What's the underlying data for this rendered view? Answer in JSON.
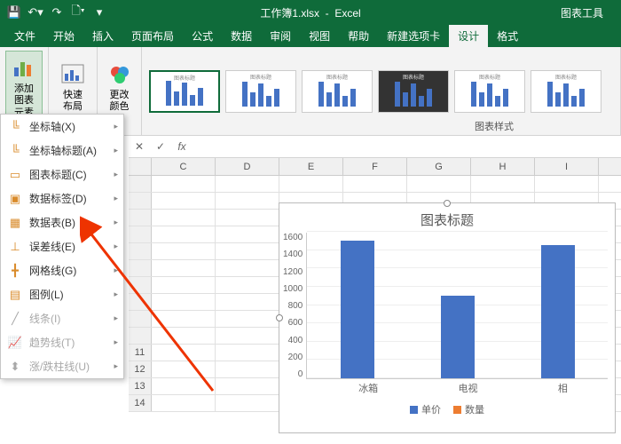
{
  "title": {
    "filename": "工作簿1.xlsx",
    "app": "Excel",
    "contextTab": "图表工具"
  },
  "tabs": {
    "file": "文件",
    "home": "开始",
    "insert": "插入",
    "pageLayout": "页面布局",
    "formulas": "公式",
    "data": "数据",
    "review": "审阅",
    "view": "视图",
    "help": "帮助",
    "newTab": "新建选项卡",
    "design": "设计",
    "format": "格式"
  },
  "ribbon": {
    "addChartElement": "添加图表\n元素",
    "quickLayout": "快速布局",
    "changeColors": "更改\n颜色",
    "chartStyles": "图表样式"
  },
  "menu": {
    "axes": "坐标轴(X)",
    "axisTitles": "坐标轴标题(A)",
    "chartTitle": "图表标题(C)",
    "dataLabels": "数据标签(D)",
    "dataTable": "数据表(B)",
    "errorBars": "误差线(E)",
    "gridlines": "网格线(G)",
    "legend": "图例(L)",
    "lines": "线条(I)",
    "trendline": "趋势线(T)",
    "upDownBars": "涨/跌柱线(U)"
  },
  "formula": {
    "fx": "fx"
  },
  "columns": [
    "C",
    "D",
    "E",
    "F",
    "G",
    "H",
    "I"
  ],
  "rows": [
    "11",
    "12",
    "13",
    "14"
  ],
  "chart_data": {
    "type": "bar",
    "title": "图表标题",
    "categories": [
      "冰箱",
      "电视",
      "相"
    ],
    "series": [
      {
        "name": "单价",
        "values": [
          1500,
          900,
          1450
        ]
      },
      {
        "name": "数量",
        "values": [
          20,
          18,
          22
        ]
      }
    ],
    "ylim": [
      0,
      1600
    ],
    "yticks": [
      0,
      200,
      400,
      600,
      800,
      1000,
      1200,
      1400,
      1600
    ],
    "xlabel": "",
    "ylabel": ""
  }
}
